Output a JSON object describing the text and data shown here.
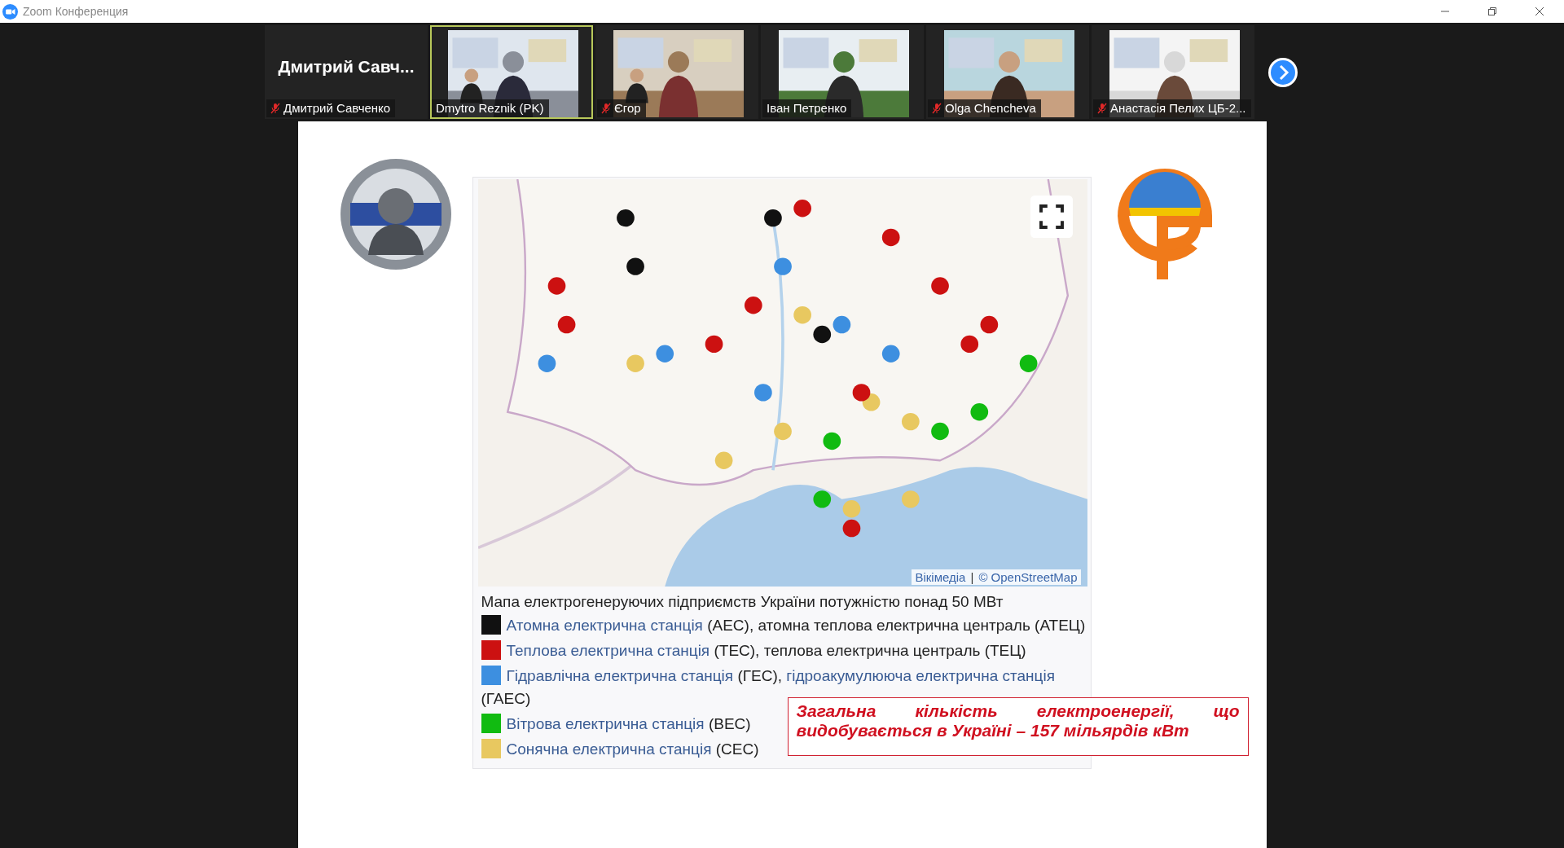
{
  "window": {
    "title": "Zoom Конференция"
  },
  "participants": [
    {
      "kind": "name-only",
      "display": "Дмитрий Савч...",
      "name": "Дмитрий Савченко",
      "muted": true,
      "speaking": false
    },
    {
      "kind": "video",
      "name": "Dmytro Reznik (PK)",
      "muted": false,
      "speaking": true
    },
    {
      "kind": "video",
      "name": "Єгор",
      "muted": true,
      "speaking": false
    },
    {
      "kind": "video",
      "name": "Іван Петренко",
      "muted": false,
      "speaking": false
    },
    {
      "kind": "video",
      "name": "Olga Chencheva",
      "muted": true,
      "speaking": false
    },
    {
      "kind": "video",
      "name": "Анастасія Пелих ЦБ-2...",
      "muted": true,
      "speaking": false
    }
  ],
  "slide": {
    "map": {
      "attribution": [
        "Вікімедіа",
        "|",
        "© OpenStreetMap"
      ]
    },
    "caption": "Мапа електрогенеруючих підприємств України потужністю понад 50 МВт",
    "legend": [
      {
        "color": "#111111",
        "parts": [
          {
            "kind": "link",
            "text": "Атомна електрична станція"
          },
          {
            "kind": "text",
            "text": " (АЕС), атомна теплова електрична централь (АТЕЦ)"
          }
        ]
      },
      {
        "color": "#cc1111",
        "parts": [
          {
            "kind": "link",
            "text": "Теплова електрична станція"
          },
          {
            "kind": "text",
            "text": " (ТЕС), теплова електрична централь (ТЕЦ)"
          }
        ]
      },
      {
        "color": "#3d8fe0",
        "parts": [
          {
            "kind": "link",
            "text": "Гідравлічна електрична станція"
          },
          {
            "kind": "text",
            "text": " (ГЕС), "
          },
          {
            "kind": "link",
            "text": "гідроакумулююча електрична станція"
          },
          {
            "kind": "text",
            "text": " (ГАЕС)"
          }
        ]
      },
      {
        "color": "#11bb11",
        "parts": [
          {
            "kind": "link",
            "text": "Вітрова електрична станція"
          },
          {
            "kind": "text",
            "text": " (ВЕС)"
          }
        ]
      },
      {
        "color": "#e8c860",
        "parts": [
          {
            "kind": "link",
            "text": "Сонячна електрична станція"
          },
          {
            "kind": "text",
            "text": " (СЕС)"
          }
        ]
      }
    ],
    "note": "Загальна кількість електроенергії, що видобувається в Україні – 157 мільярдів кВт"
  }
}
